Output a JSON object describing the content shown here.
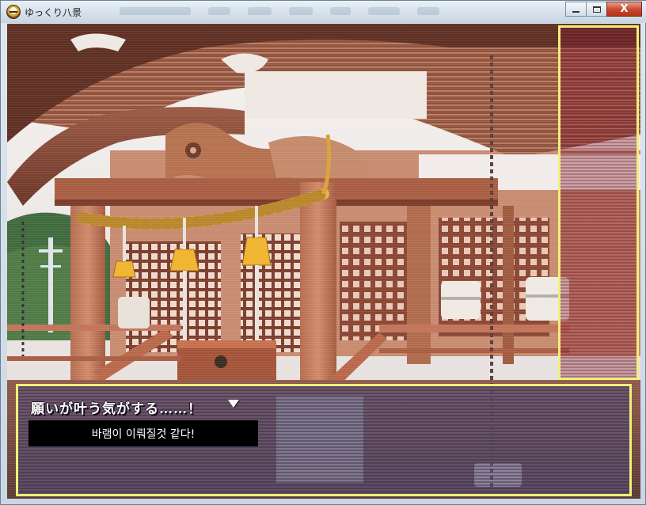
{
  "window": {
    "title": "ゆっくり八景",
    "close_glyph": "X",
    "accent_border": "#f1ef7c"
  },
  "icons": {
    "app": "yukkuri-face-icon",
    "minimize": "minimize-icon",
    "maximize": "maximize-icon",
    "close": "close-icon",
    "next": "triangle-down-icon"
  },
  "message": {
    "line": "願いが叶う気がする……！",
    "translation": "바램이 이뤄질것 같다!"
  }
}
